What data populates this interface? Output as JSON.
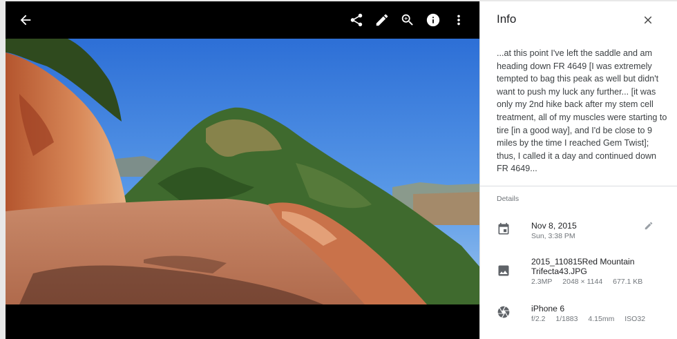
{
  "toolbar": {
    "icons": [
      "back-arrow-icon",
      "share-icon",
      "edit-pencil-icon",
      "zoom-in-icon",
      "info-icon",
      "more-vert-icon"
    ]
  },
  "photo": {
    "subject": ""
  },
  "info": {
    "title": "Info",
    "description": "...at this point I've left the saddle and am heading down FR 4649 [I was extremely tempted to bag this peak as well but didn't want to push my luck any further... [it was only my 2nd hike back after my stem cell treatment, all of my muscles were starting to tire [in a good way], and I'd be close to 9 miles by the time I reached Gem Twist]; thus, I called it a day and continued down FR 4649...",
    "details_label": "Details",
    "date": {
      "main": "Nov 8, 2015",
      "sub": "Sun, 3:38 PM"
    },
    "file": {
      "name": "2015_110815Red Mountain Trifecta43.JPG",
      "megapixels": "2.3MP",
      "dimensions": "2048 × 1144",
      "size": "677.1 KB"
    },
    "camera": {
      "model": "iPhone 6",
      "aperture": "f/2.2",
      "shutter": "1/1883",
      "focal": "4.15mm",
      "iso": "ISO32"
    }
  }
}
